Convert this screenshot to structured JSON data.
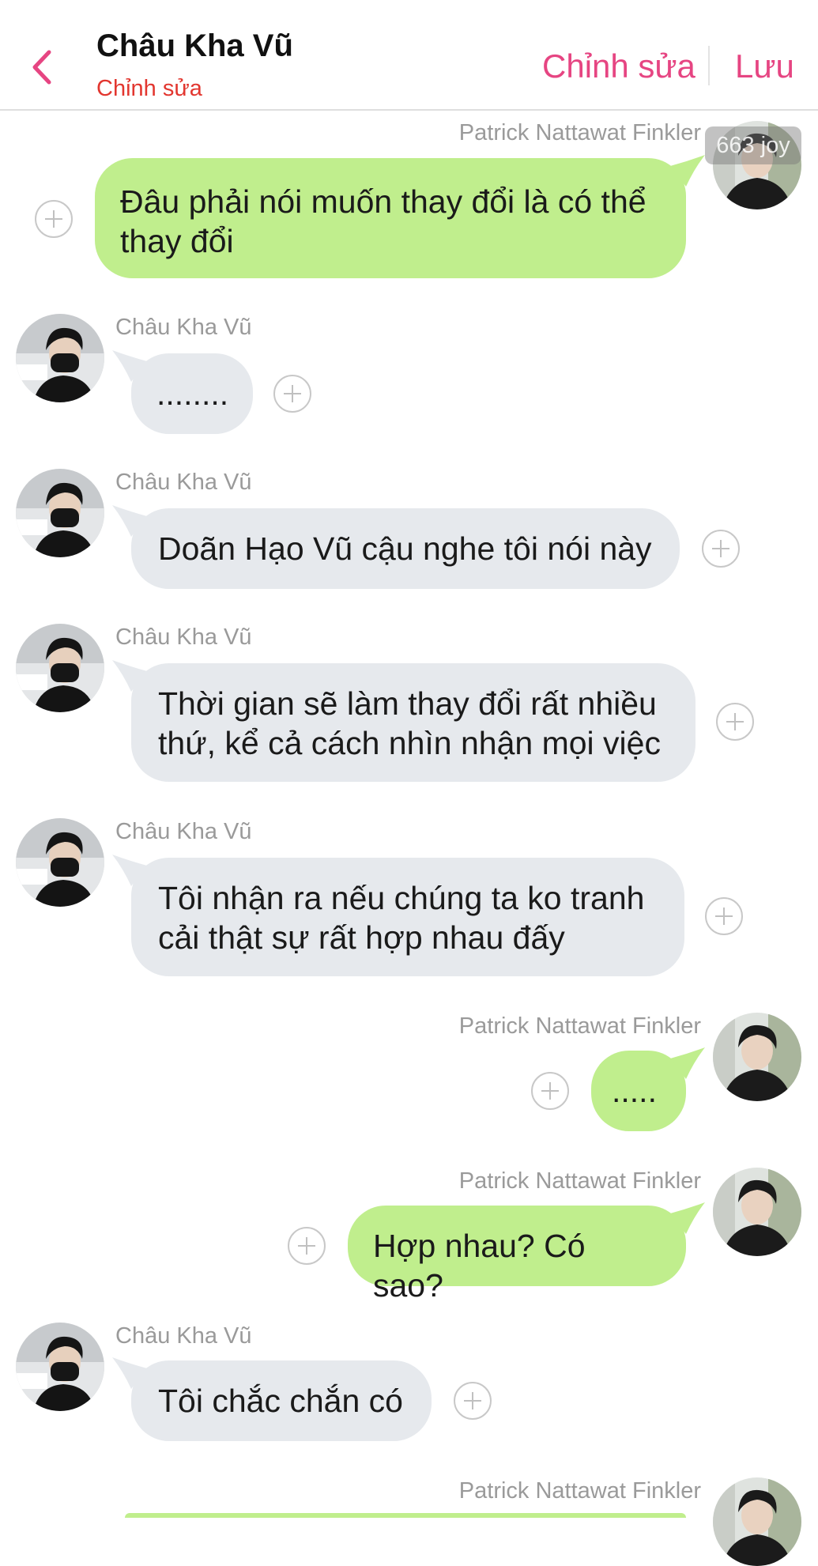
{
  "header": {
    "title": "Châu Kha Vũ",
    "subtitle": "Chỉnh sửa",
    "edit_label": "Chỉnh sửa",
    "save_label": "Lưu"
  },
  "watermark": "663 joy",
  "colors": {
    "accent": "#e64582",
    "subtitle": "#e2362f",
    "outgoing_bubble": "#c0ee8d",
    "incoming_bubble": "#e6e9ed"
  },
  "messages": [
    {
      "sender": "Patrick Nattawat Finkler",
      "text": "Đâu phải nói muốn thay đổi là có thể\nthay đổi"
    },
    {
      "sender": "Châu Kha Vũ",
      "text": "........"
    },
    {
      "sender": "Châu Kha Vũ",
      "text": "Doãn Hạo Vũ cậu nghe tôi nói này"
    },
    {
      "sender": "Châu Kha Vũ",
      "text": "Thời gian sẽ làm thay đổi rất nhiều\nthứ, kể cả cách nhìn nhận mọi việc"
    },
    {
      "sender": "Châu Kha Vũ",
      "text": "Tôi nhận ra nếu chúng ta ko tranh\ncải thật sự rất hợp nhau đấy"
    },
    {
      "sender": "Patrick Nattawat Finkler",
      "text": "....."
    },
    {
      "sender": "Patrick Nattawat Finkler",
      "text": "Hợp nhau? Có sao?"
    },
    {
      "sender": "Châu Kha Vũ",
      "text": "Tôi chắc chắn có"
    },
    {
      "sender": "Patrick Nattawat Finkler",
      "text": ""
    }
  ]
}
